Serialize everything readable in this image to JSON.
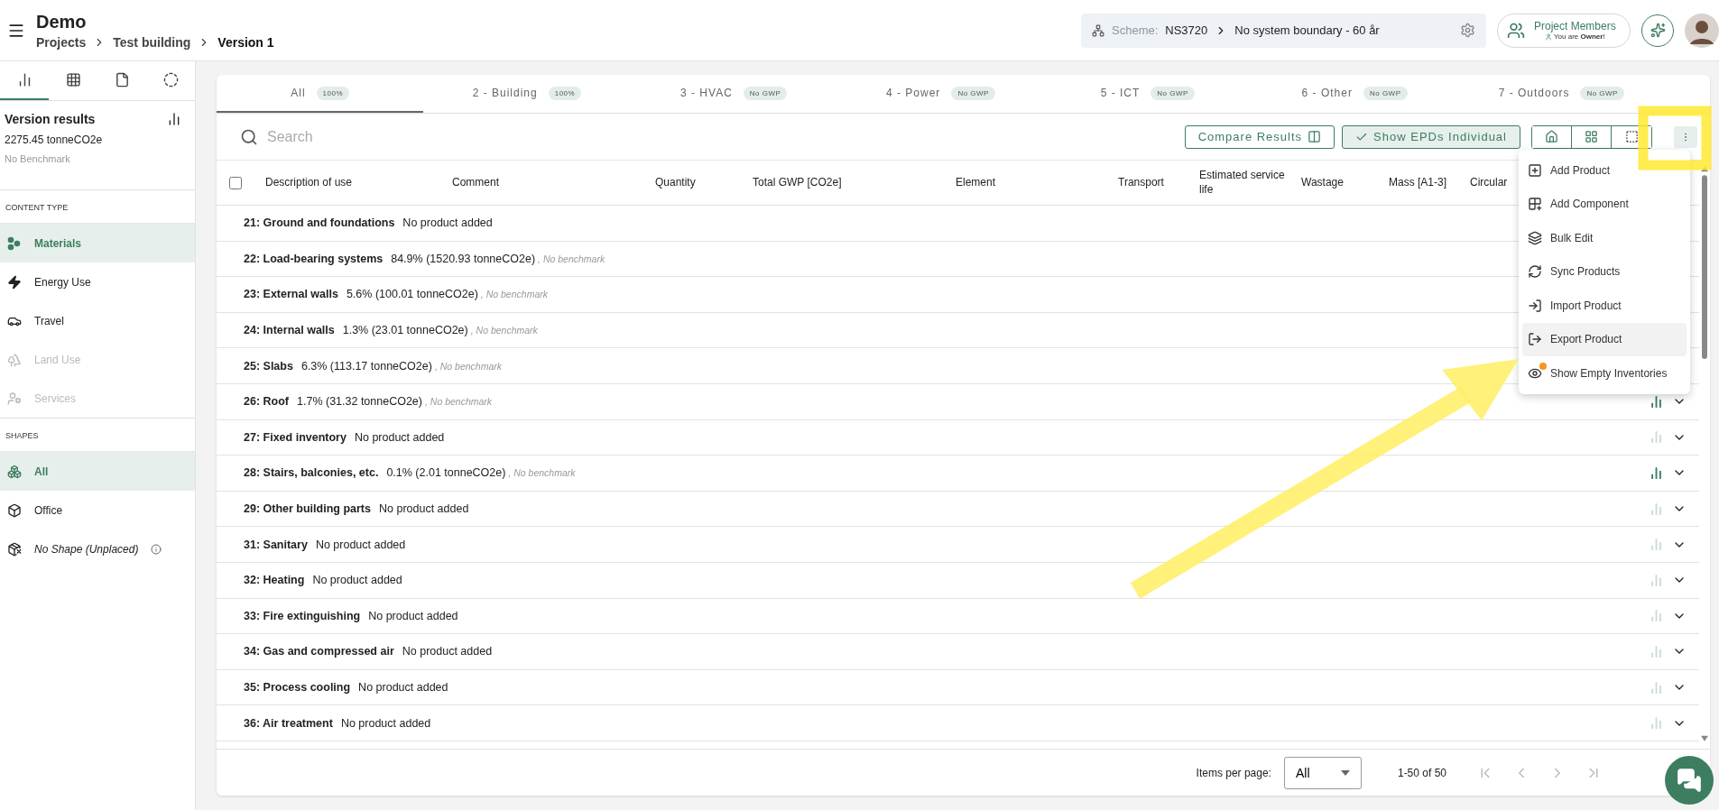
{
  "header": {
    "title": "Demo",
    "breadcrumbs": [
      "Projects",
      "Test building",
      "Version 1"
    ],
    "scheme": {
      "label": "Scheme:",
      "value": "NS3720",
      "boundary": "No system boundary - 60 år"
    },
    "members": {
      "label": "Project Members",
      "role_prefix": "You are ",
      "role": "Owner",
      "role_suffix": "!"
    }
  },
  "sidebar": {
    "tabs": [
      {
        "kind": "chart",
        "selected": true
      },
      {
        "kind": "grid",
        "selected": false
      },
      {
        "kind": "file",
        "selected": false
      },
      {
        "kind": "target",
        "selected": false
      }
    ],
    "results": {
      "title": "Version results",
      "value": "2275.45 tonneCO2e",
      "benchmark": "No Benchmark"
    },
    "content_type": {
      "heading": "CONTENT TYPE",
      "items": [
        {
          "kind": "materials",
          "label": "Materials",
          "selected": true,
          "disabled": false
        },
        {
          "kind": "energy",
          "label": "Energy Use",
          "selected": false,
          "disabled": false
        },
        {
          "kind": "travel",
          "label": "Travel",
          "selected": false,
          "disabled": false
        },
        {
          "kind": "land",
          "label": "Land Use",
          "selected": false,
          "disabled": true
        },
        {
          "kind": "services",
          "label": "Services",
          "selected": false,
          "disabled": true
        }
      ]
    },
    "shapes": {
      "heading": "SHAPES",
      "items": [
        {
          "kind": "all",
          "label": "All",
          "selected": true,
          "info": false
        },
        {
          "kind": "office",
          "label": "Office",
          "selected": false,
          "info": false
        },
        {
          "kind": "none",
          "label": "No Shape (Unplaced)",
          "selected": false,
          "info": true
        }
      ]
    }
  },
  "tabs": [
    {
      "label": "All",
      "badge": "100%",
      "selected": true
    },
    {
      "label": "2 - Building",
      "badge": "100%",
      "selected": false
    },
    {
      "label": "3 - HVAC",
      "badge": "No GWP",
      "selected": false
    },
    {
      "label": "4 - Power",
      "badge": "No GWP",
      "selected": false
    },
    {
      "label": "5 - ICT",
      "badge": "No GWP",
      "selected": false
    },
    {
      "label": "6 - Other",
      "badge": "No GWP",
      "selected": false
    },
    {
      "label": "7 - Outdoors",
      "badge": "No GWP",
      "selected": false
    }
  ],
  "toolbar": {
    "search": {
      "placeholder": "Search"
    },
    "compare": "Compare Results",
    "epds": {
      "label": "Show EPDs Individual",
      "on": true
    }
  },
  "table": {
    "select_all_checked": false,
    "columns": [
      "Description of use",
      "Comment",
      "Quantity",
      "Total GWP [CO2e]",
      "Element",
      "Transport",
      "Estimated service life",
      "Wastage",
      "Mass [A1-3]",
      "Circular"
    ],
    "rows": [
      {
        "name": "21: Ground and foundations",
        "detail": "No product added"
      },
      {
        "name": "22: Load-bearing systems",
        "detail": "84.9% (1520.93 tonneCO2e)",
        "benchmark": ", No benchmark"
      },
      {
        "name": "23: External walls",
        "detail": "5.6% (100.01 tonneCO2e)",
        "benchmark": ", No benchmark"
      },
      {
        "name": "24: Internal walls",
        "detail": "1.3% (23.01 tonneCO2e)",
        "benchmark": ", No benchmark"
      },
      {
        "name": "25: Slabs",
        "detail": "6.3% (113.17 tonneCO2e)",
        "benchmark": ", No benchmark"
      },
      {
        "name": "26: Roof",
        "detail": "1.7% (31.32 tonneCO2e)",
        "benchmark": ", No benchmark",
        "chart_active": true
      },
      {
        "name": "27: Fixed inventory",
        "detail": "No product added",
        "chart_active": false
      },
      {
        "name": "28: Stairs, balconies, etc.",
        "detail": "0.1% (2.01 tonneCO2e)",
        "benchmark": ", No benchmark",
        "chart_active": true
      },
      {
        "name": "29: Other building parts",
        "detail": "No product added",
        "chart_active": false
      },
      {
        "name": "31: Sanitary",
        "detail": "No product added",
        "chart_active": false
      },
      {
        "name": "32: Heating",
        "detail": "No product added",
        "chart_active": false
      },
      {
        "name": "33: Fire extinguishing",
        "detail": "No product added",
        "chart_active": false
      },
      {
        "name": "34: Gas and compressed air",
        "detail": "No product added",
        "chart_active": false
      },
      {
        "name": "35: Process cooling",
        "detail": "No product added",
        "chart_active": false
      },
      {
        "name": "36: Air treatment",
        "detail": "No product added",
        "chart_active": false
      }
    ]
  },
  "menu": {
    "items": [
      {
        "kind": "add",
        "label": "Add Product",
        "highlighted": false,
        "badge": false
      },
      {
        "kind": "component",
        "label": "Add Component",
        "highlighted": false,
        "badge": false
      },
      {
        "kind": "bulk",
        "label": "Bulk Edit",
        "highlighted": false,
        "badge": false
      },
      {
        "kind": "sync",
        "label": "Sync Products",
        "highlighted": false,
        "badge": false
      },
      {
        "kind": "import",
        "label": "Import Product",
        "highlighted": false,
        "badge": false
      },
      {
        "kind": "export",
        "label": "Export Product",
        "highlighted": true,
        "badge": false
      },
      {
        "kind": "eye",
        "label": "Show Empty Inventories",
        "highlighted": false,
        "badge": true
      }
    ]
  },
  "pagination": {
    "label": "Items per page:",
    "per_page": "All",
    "range": "1-50 of 50"
  },
  "annotations": {
    "frame": true,
    "arrow": true
  }
}
